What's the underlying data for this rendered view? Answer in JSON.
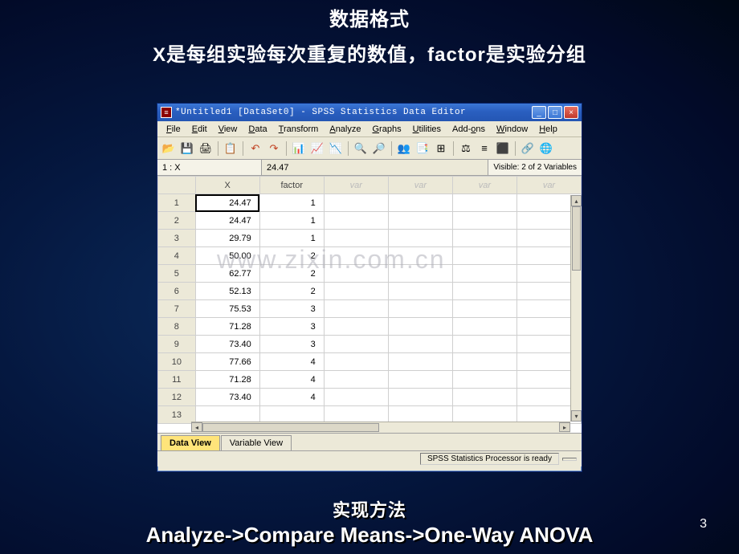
{
  "slide": {
    "title_l1": "数据格式",
    "title_l2": "X是每组实验每次重复的数值，factor是实验分组",
    "method_label": "实现方法",
    "method_path": "Analyze->Compare Means->One-Way ANOVA",
    "page_number": "3",
    "watermark": "www.zixin.com.cn"
  },
  "window": {
    "title": "*Untitled1 [DataSet0] - SPSS Statistics Data Editor",
    "menus": [
      "File",
      "Edit",
      "View",
      "Data",
      "Transform",
      "Analyze",
      "Graphs",
      "Utilities",
      "Add-ons",
      "Window",
      "Help"
    ],
    "cell_ref": "1 : X",
    "cell_value": "24.47",
    "visible_vars": "Visible: 2 of 2 Variables",
    "columns": [
      "X",
      "factor",
      "var",
      "var",
      "var",
      "var"
    ],
    "rows": [
      {
        "n": "1",
        "x": "24.47",
        "f": "1"
      },
      {
        "n": "2",
        "x": "24.47",
        "f": "1"
      },
      {
        "n": "3",
        "x": "29.79",
        "f": "1"
      },
      {
        "n": "4",
        "x": "50.00",
        "f": "2"
      },
      {
        "n": "5",
        "x": "62.77",
        "f": "2"
      },
      {
        "n": "6",
        "x": "52.13",
        "f": "2"
      },
      {
        "n": "7",
        "x": "75.53",
        "f": "3"
      },
      {
        "n": "8",
        "x": "71.28",
        "f": "3"
      },
      {
        "n": "9",
        "x": "73.40",
        "f": "3"
      },
      {
        "n": "10",
        "x": "77.66",
        "f": "4"
      },
      {
        "n": "11",
        "x": "71.28",
        "f": "4"
      },
      {
        "n": "12",
        "x": "73.40",
        "f": "4"
      },
      {
        "n": "13",
        "x": "",
        "f": ""
      }
    ],
    "tabs": {
      "data": "Data View",
      "variable": "Variable View"
    },
    "status": "SPSS Statistics Processor is ready"
  },
  "toolbar_icons": [
    "📂",
    "💾",
    "🖨",
    "📋",
    "↶",
    "↷",
    "📊",
    "📈",
    "📉",
    "🔍",
    "🔎",
    "👥",
    "📑",
    "⊞",
    "⚖",
    "≡",
    "⬛",
    "🔗",
    "🌐"
  ]
}
